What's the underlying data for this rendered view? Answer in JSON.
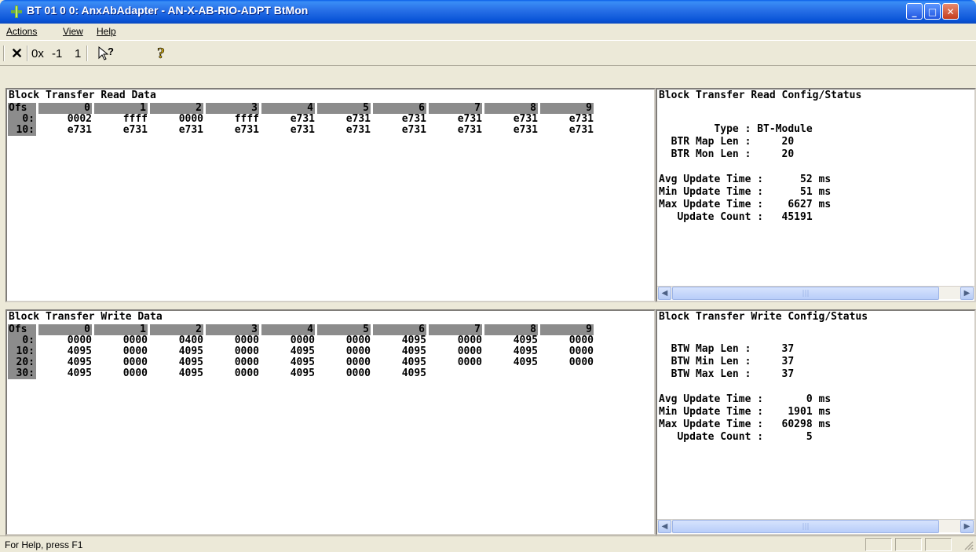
{
  "window": {
    "title": "BT 01 0 0: AnxAbAdapter - AN-X-AB-RIO-ADPT BtMon",
    "app_icon": "plug-icon"
  },
  "menu": [
    "Actions",
    "View",
    "Help"
  ],
  "toolbar": {
    "tools": [
      {
        "name": "close-x-icon",
        "label": "✕"
      },
      {
        "name": "hex-toggle",
        "label": "0x"
      },
      {
        "name": "minus-one",
        "label": "-1"
      },
      {
        "name": "plus-one",
        "label": "1"
      },
      {
        "name": "context-help-icon",
        "label": "?"
      },
      {
        "name": "about-help-icon",
        "label": "?"
      }
    ]
  },
  "read_data": {
    "title": "Block Transfer Read Data",
    "ofs_label": "Ofs",
    "columns": [
      "0",
      "1",
      "2",
      "3",
      "4",
      "5",
      "6",
      "7",
      "8",
      "9"
    ],
    "rows": [
      {
        "label": "0:",
        "values": [
          "0002",
          "ffff",
          "0000",
          "ffff",
          "e731",
          "e731",
          "e731",
          "e731",
          "e731",
          "e731"
        ]
      },
      {
        "label": "10:",
        "values": [
          "e731",
          "e731",
          "e731",
          "e731",
          "e731",
          "e731",
          "e731",
          "e731",
          "e731",
          "e731"
        ]
      }
    ]
  },
  "read_status": {
    "title": "Block Transfer Read Config/Status",
    "lines": [
      "         Type : BT-Module",
      "  BTR Map Len :     20",
      "  BTR Mon Len :     20",
      "",
      "Avg Update Time :      52 ms",
      "Min Update Time :      51 ms",
      "Max Update Time :    6627 ms",
      "   Update Count :   45191"
    ]
  },
  "write_data": {
    "title": "Block Transfer Write Data",
    "ofs_label": "Ofs",
    "columns": [
      "0",
      "1",
      "2",
      "3",
      "4",
      "5",
      "6",
      "7",
      "8",
      "9"
    ],
    "rows": [
      {
        "label": "0:",
        "values": [
          "0000",
          "0000",
          "0400",
          "0000",
          "0000",
          "0000",
          "4095",
          "0000",
          "4095",
          "0000"
        ]
      },
      {
        "label": "10:",
        "values": [
          "4095",
          "0000",
          "4095",
          "0000",
          "4095",
          "0000",
          "4095",
          "0000",
          "4095",
          "0000"
        ]
      },
      {
        "label": "20:",
        "values": [
          "4095",
          "0000",
          "4095",
          "0000",
          "4095",
          "0000",
          "4095",
          "0000",
          "4095",
          "0000"
        ]
      },
      {
        "label": "30:",
        "values": [
          "4095",
          "0000",
          "4095",
          "0000",
          "4095",
          "0000",
          "4095"
        ]
      }
    ]
  },
  "write_status": {
    "title": "Block Transfer Write Config/Status",
    "lines": [
      "",
      "  BTW Map Len :     37",
      "  BTW Min Len :     37",
      "  BTW Max Len :     37",
      "",
      "Avg Update Time :       0 ms",
      "Min Update Time :    1901 ms",
      "Max Update Time :   60298 ms",
      "   Update Count :       5"
    ]
  },
  "status_bar": {
    "text": "For Help, press F1"
  }
}
